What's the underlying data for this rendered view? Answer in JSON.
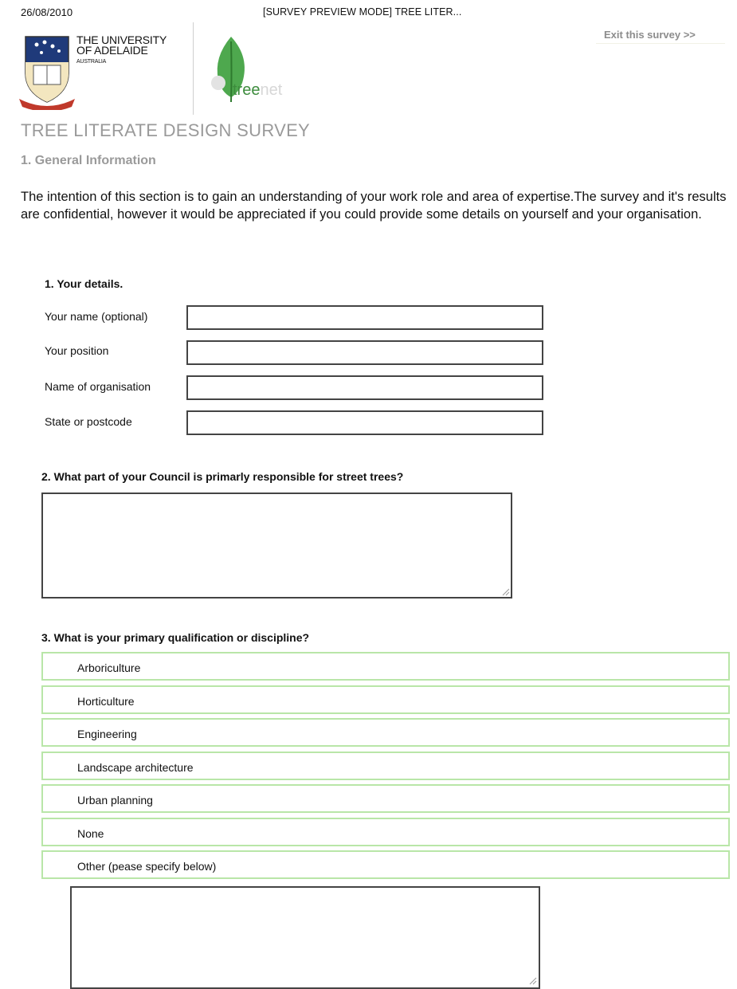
{
  "header": {
    "date": "26/08/2010",
    "title": "[SURVEY PREVIEW MODE] TREE LITER...",
    "exit_link": "Exit this survey >>"
  },
  "logos": {
    "university_line1": "THE UNIVERSITY",
    "university_line2": "OF ADELAIDE",
    "university_line3": "AUSTRALIA",
    "treenet_part1": "tree",
    "treenet_part2": "net",
    "colors": {
      "treenet_green": "#3d8c3d",
      "crest_red": "#c0392b",
      "crest_blue": "#1f3a7a"
    }
  },
  "survey": {
    "title": "TREE LITERATE DESIGN SURVEY",
    "section": "1. General Information",
    "intro": "The intention of this section is to gain an understanding of your work role and area of expertise.The survey and it's results are confidential, however it would be appreciated if you could provide some details on yourself and your organisation."
  },
  "q1": {
    "label": "1. Your details.",
    "fields": [
      {
        "label": "Your name (optional)",
        "value": ""
      },
      {
        "label": "Your position",
        "value": ""
      },
      {
        "label": "Name of organisation",
        "value": ""
      },
      {
        "label": "State or postcode",
        "value": ""
      }
    ]
  },
  "q2": {
    "label": "2. What part of your Council is primarly responsible for street trees?",
    "value": ""
  },
  "q3": {
    "label": "3. What is your primary qualification or discipline?",
    "options": [
      "Arboriculture",
      "Horticulture",
      "Engineering",
      "Landscape architecture",
      "Urban planning",
      "None",
      "Other (pease specify below)"
    ],
    "other_value": "",
    "option_border_color": "#b9e6a8"
  }
}
